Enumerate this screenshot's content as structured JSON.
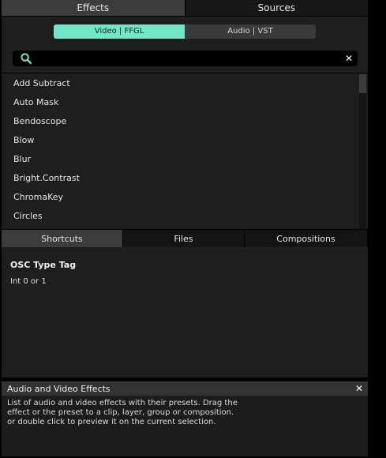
{
  "top_tabs": [
    {
      "label": "Effects",
      "active": true
    },
    {
      "label": "Sources",
      "active": false
    }
  ],
  "filter": {
    "video_label": "Video | FFGL",
    "audio_label": "Audio | VST",
    "selected": "Video | FFGL"
  },
  "search": {
    "value": "",
    "icon": "search-icon",
    "clear_icon": "close-icon"
  },
  "effects": [
    "Add Subtract",
    "Auto Mask",
    "Bendoscope",
    "Blow",
    "Blur",
    "Bright.Contrast",
    "ChromaKey",
    "Circles"
  ],
  "bottom_tabs": [
    {
      "label": "Shortcuts",
      "active": true
    },
    {
      "label": "Files",
      "active": false
    },
    {
      "label": "Compositions",
      "active": false
    }
  ],
  "shortcuts": {
    "title": "OSC Type Tag",
    "value": "Int 0 or 1"
  },
  "help": {
    "title": "Audio and Video Effects",
    "lines": [
      "List of audio and video effects with their presets. Drag the",
      "effect or the preset to a clip, layer, group or composition.",
      "or double click to preview it on the current selection."
    ]
  },
  "colors": {
    "accent": "#6fe8c6",
    "background": "#1e1e1e",
    "tab_active": "#3c3c3c"
  }
}
